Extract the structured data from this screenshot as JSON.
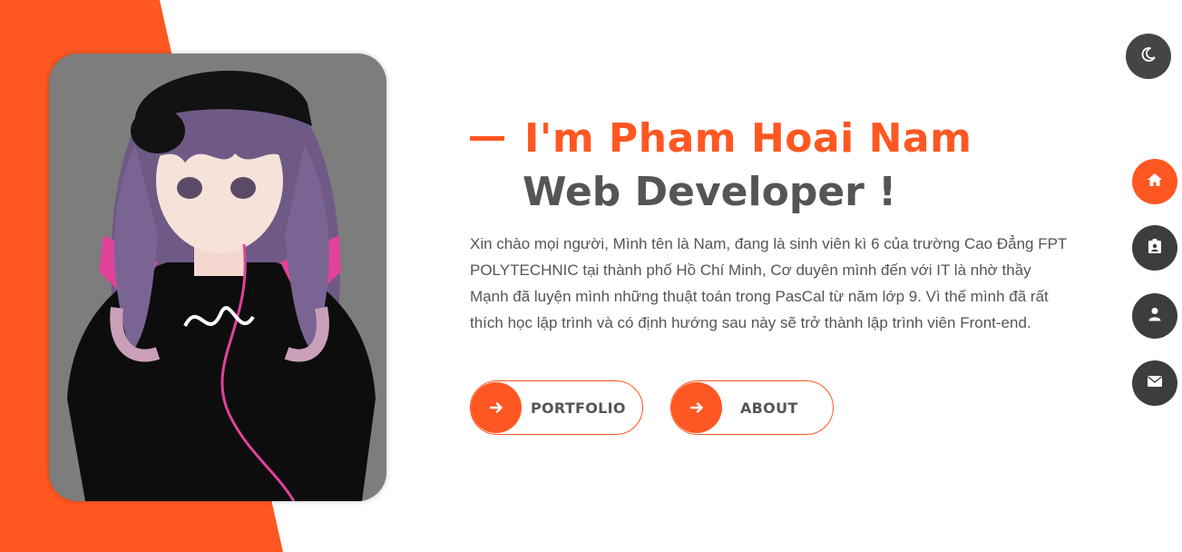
{
  "hero": {
    "name_line": "I'm Pham Hoai Nam",
    "role_line": "Web Developer !",
    "intro": "Xin chào mọi người, Mình tên là Nam, đang là sinh viên kì 6 của trường Cao Đẳng FPT POLYTECHNIC tại thành phố Hồ Chí Minh, Cơ duyên mình đến với IT là nhờ thầy Mạnh đã luyện mình những thuật toán trong PasCal từ năm lớp 9. Vì thế mình đã rất thích học lập trình và có định hướng sau này sẽ trở thành lập trình viên Front-end."
  },
  "buttons": {
    "portfolio_label": "PORTFOLIO",
    "about_label": "ABOUT",
    "icon": "arrow-right-icon"
  },
  "theme_toggle": {
    "icon": "moon-icon"
  },
  "side_nav": {
    "items": [
      {
        "id": "home",
        "icon": "home-icon",
        "active": true
      },
      {
        "id": "resume",
        "icon": "id-badge-icon",
        "active": false
      },
      {
        "id": "about",
        "icon": "user-icon",
        "active": false
      },
      {
        "id": "contact",
        "icon": "envelope-icon",
        "active": false
      }
    ]
  },
  "colors": {
    "accent": "#ff5722",
    "text": "#555555",
    "nav_dark": "#3d3d3d",
    "portrait_bg": "#7d7d7d"
  }
}
